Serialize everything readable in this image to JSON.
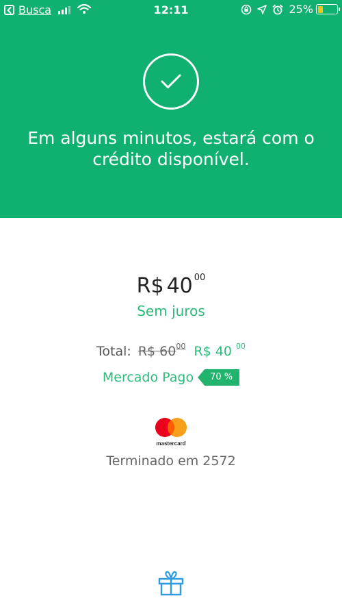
{
  "status_bar": {
    "back_label": "Busca",
    "time": "12:11",
    "battery_percent": "25%",
    "battery_level": 0.25,
    "icons": [
      "chevron-left-icon",
      "signal-icon",
      "wifi-icon",
      "rotation-lock-icon",
      "location-icon",
      "alarm-icon",
      "battery-icon"
    ]
  },
  "hero": {
    "background_color": "#0fb070",
    "icon": "check-circle-icon",
    "message": "Em alguns minutos, estará com o crédito disponível."
  },
  "payment": {
    "currency": "R$",
    "amount_int": "40",
    "amount_cents": "00",
    "installment_note": "Sem juros",
    "total_label": "Total:",
    "original_currency": "R$",
    "original_int": "60",
    "original_cents": "00",
    "final_currency": "R$",
    "final_int": "40",
    "final_cents": "00",
    "discount_label": "Mercado Pago",
    "discount_badge": "70 %",
    "accent_color": "#2dbb7a"
  },
  "card": {
    "brand_text": "mastercard",
    "ending_text": "Terminado em 2572",
    "logo_colors": [
      "#eb001b",
      "#f79e1b"
    ]
  },
  "footer": {
    "icon": "gift-icon"
  }
}
